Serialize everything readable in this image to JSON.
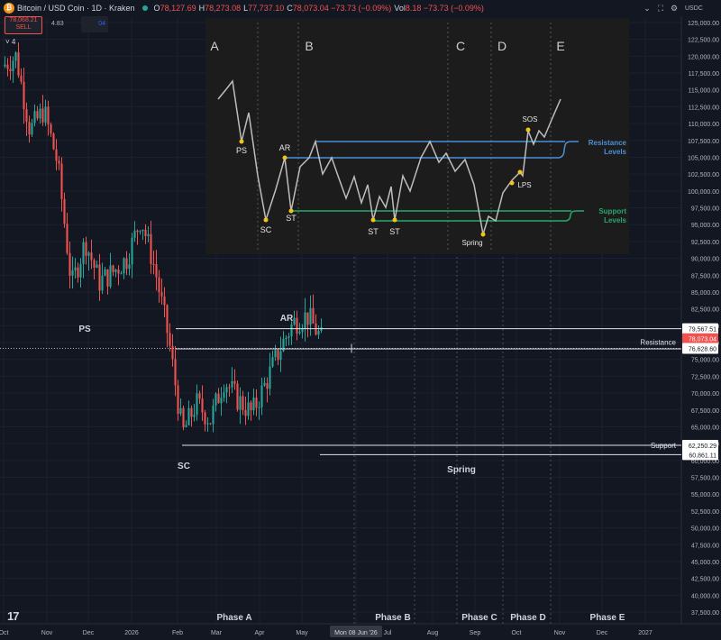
{
  "header": {
    "symbol": "Bitcoin / USD Coin · 1D · Kraken",
    "ohlc": [
      {
        "k": "O",
        "v": "78,127.69"
      },
      {
        "k": "H",
        "v": "78,273.08"
      },
      {
        "k": "L",
        "v": "77,737.10"
      },
      {
        "k": "C",
        "v": "78,073.04 −73.73 (−0.09%)"
      },
      {
        "k": "Vol",
        "v": "8.18 −73.73 (−0.09%)"
      }
    ],
    "sell_price": "78,068.21",
    "sell_label": "SELL",
    "spread": "4.83",
    "qty": "04",
    "indicator_count": "4",
    "currency": "USDC"
  },
  "colors": {
    "bg": "#131722",
    "up": "#26a69a",
    "down": "#ef5350",
    "inset_bg": "#1c1c1c",
    "inset_blue": "#4a90d9",
    "inset_green": "#27a86a",
    "marker": "#f0c419"
  },
  "chart_data": {
    "type": "candlestick",
    "y_ticks": [
      "125,000.00",
      "122,500.00",
      "120,000.00",
      "117,500.00",
      "115,000.00",
      "112,500.00",
      "110,000.00",
      "107,500.00",
      "105,000.00",
      "102,500.00",
      "100,000.00",
      "97,500.00",
      "95,000.00",
      "92,500.00",
      "90,000.00",
      "87,500.00",
      "85,000.00",
      "82,500.00",
      "80,000.00",
      "77,500.00",
      "75,000.00",
      "72,500.00",
      "70,000.00",
      "67,500.00",
      "65,000.00",
      "62,500.00",
      "60,000.00",
      "57,500.00",
      "55,000.00",
      "52,500.00",
      "50,000.00",
      "47,500.00",
      "45,000.00",
      "42,500.00",
      "40,000.00",
      "37,500.00"
    ],
    "x_ticks": [
      "Oct",
      "Nov",
      "Dec",
      "2026",
      "Feb",
      "Mar",
      "Apr",
      "May",
      "Mon 08 Jun '26",
      "Jul",
      "Aug",
      "Sep",
      "Oct",
      "Nov",
      "Dec",
      "2027"
    ],
    "ylim": [
      37500,
      125000
    ],
    "price_path": [
      [
        "Oct",
        118500
      ],
      [
        "Oct-mid",
        120000
      ],
      [
        "Oct-late",
        109000
      ],
      [
        "Nov-early",
        112000
      ],
      [
        "Nov-mid",
        104000
      ],
      [
        "Nov-late",
        86000
      ],
      [
        "Dec-early",
        92500
      ],
      [
        "Dec-mid",
        86500
      ],
      [
        "Dec-late",
        88000
      ],
      [
        "2026",
        90000
      ],
      [
        "Jan-mid",
        96000
      ],
      [
        "Jan-late",
        88500
      ],
      [
        "Feb-early",
        78000
      ],
      [
        "Feb-mid",
        64000
      ],
      [
        "Feb-late",
        68500
      ],
      [
        "Mar",
        66000
      ],
      [
        "Mar-mid",
        72000
      ],
      [
        "Mar-late",
        69000
      ],
      [
        "Apr",
        67000
      ],
      [
        "Apr-mid",
        71500
      ],
      [
        "Apr-late",
        76500
      ],
      [
        "May",
        80500
      ],
      [
        "May-mid",
        81500
      ],
      [
        "May-late",
        78073
      ]
    ],
    "current_price": "78,073.04",
    "price_tags": [
      {
        "value": 79567.51,
        "label": "79,567.51"
      },
      {
        "value": 76628.6,
        "label": "76,628.60"
      },
      {
        "value": 62250.29,
        "label": "62,250.29"
      },
      {
        "value": 60861.11,
        "label": "60,861.11"
      }
    ],
    "levels": [
      {
        "name": "Resistance",
        "value": 79567.51
      },
      {
        "name": "",
        "value": 76628.6
      },
      {
        "name": "Support",
        "value": 62250.29
      },
      {
        "name": "",
        "value": 60861.11
      }
    ],
    "annotations": [
      "PS",
      "AR",
      "SC",
      "Spring"
    ],
    "phases": [
      "Phase A",
      "Phase B",
      "Phase C",
      "Phase D",
      "Phase E"
    ],
    "inset": {
      "phase_letters": [
        "A",
        "B",
        "C",
        "D",
        "E"
      ],
      "labels": [
        "PS",
        "SC",
        "AR",
        "ST",
        "ST",
        "ST",
        "Spring",
        "LPS",
        "SOS"
      ],
      "resistance_label": [
        "Resistance",
        "Levels"
      ],
      "support_label": [
        "Support",
        "Levels"
      ]
    }
  }
}
